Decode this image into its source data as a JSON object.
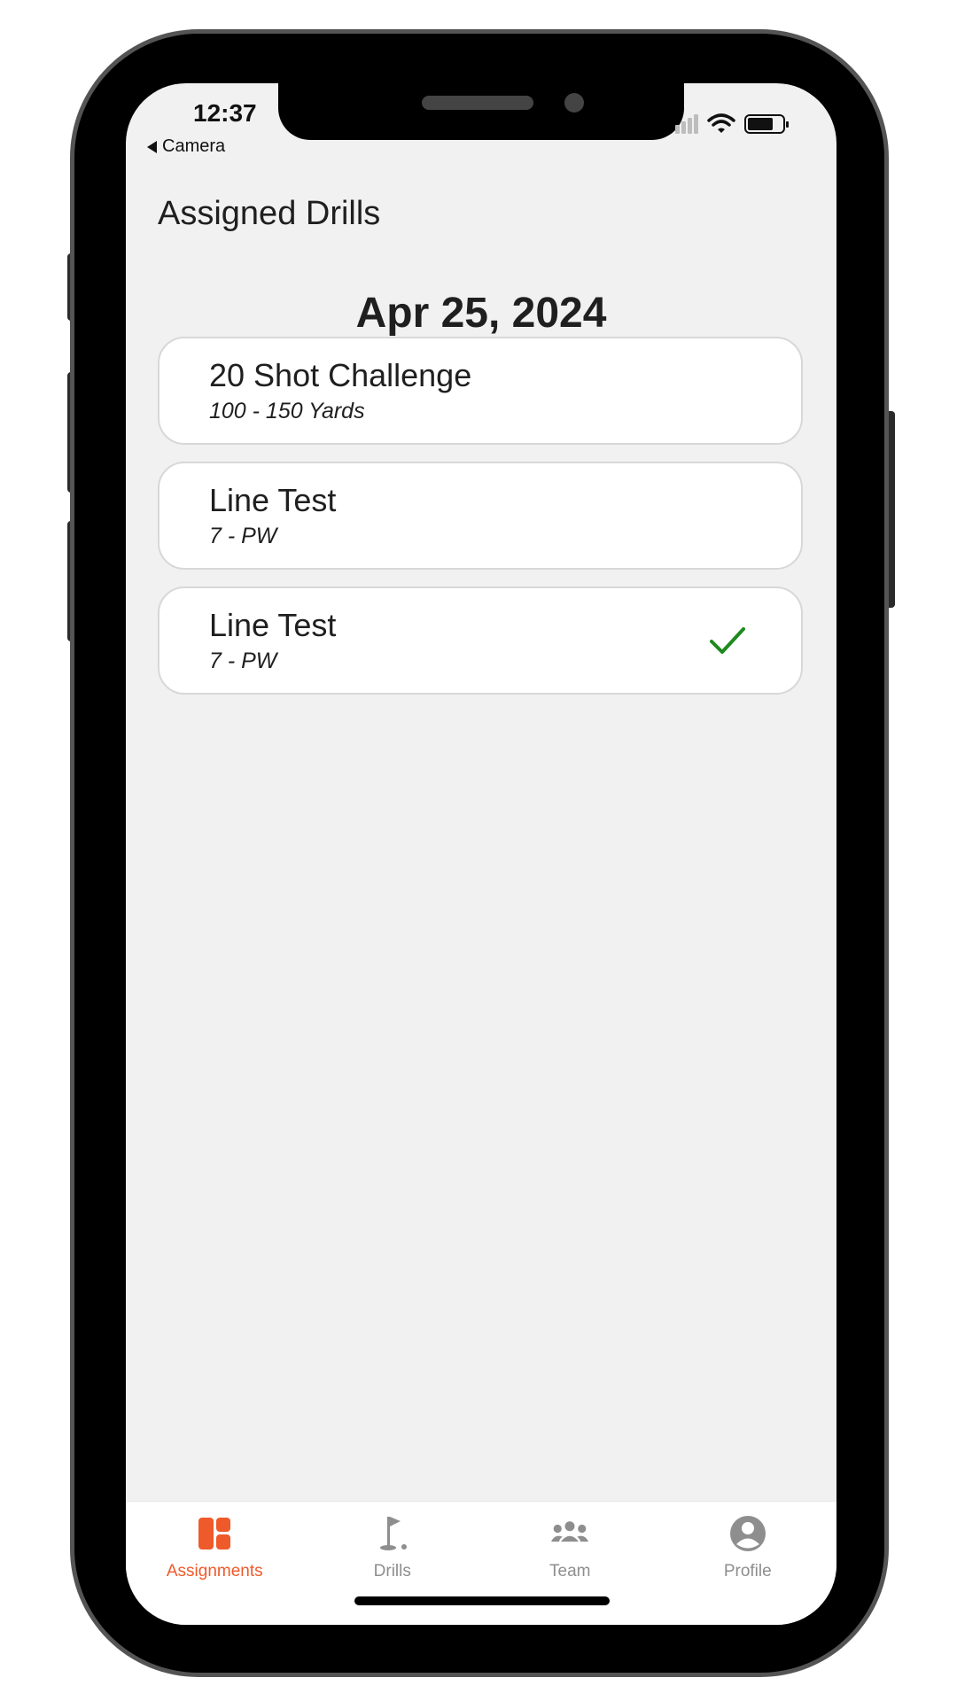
{
  "status_bar": {
    "time": "12:37",
    "back_label": "Camera"
  },
  "header": {
    "title": "Assigned Drills"
  },
  "date_group": {
    "date": "Apr 25, 2024"
  },
  "drills": [
    {
      "title": "20 Shot Challenge",
      "subtitle": "100 - 150 Yards",
      "completed": false
    },
    {
      "title": "Line Test",
      "subtitle": "7 - PW",
      "completed": false
    },
    {
      "title": "Line Test",
      "subtitle": "7 - PW",
      "completed": true
    }
  ],
  "tab_bar": {
    "active_tab": "Assignments",
    "tabs": [
      {
        "label": "Assignments",
        "icon": "assignments-icon"
      },
      {
        "label": "Drills",
        "icon": "golf-flag-icon"
      },
      {
        "label": "Team",
        "icon": "team-icon"
      },
      {
        "label": "Profile",
        "icon": "profile-icon"
      }
    ]
  },
  "colors": {
    "accent": "#ef5a2a",
    "check": "#1e8a1e",
    "inactive": "#8e8e8e",
    "background": "#f1f1f1"
  }
}
